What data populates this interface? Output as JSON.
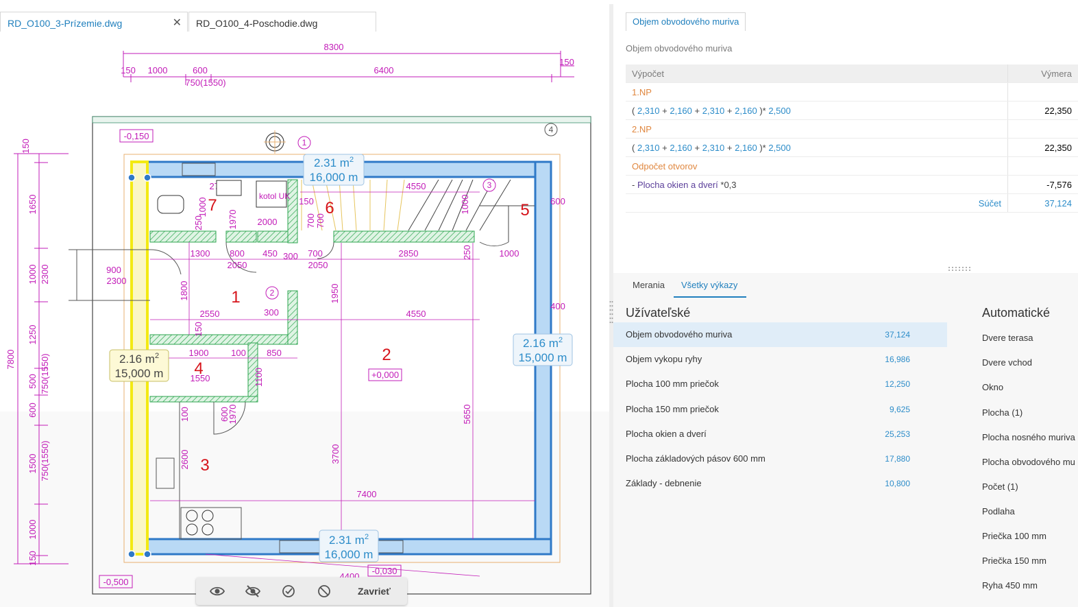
{
  "tabs": [
    {
      "label": "RD_O100_3-Prízemie.dwg",
      "active": true
    },
    {
      "label": "RD_O100_4-Poschodie.dwg",
      "active": false
    }
  ],
  "drawing": {
    "dims_top": [
      "8300",
      "150",
      "1000",
      "600",
      "6400",
      "150",
      "750(1550)"
    ],
    "dims_left": [
      "150",
      "1650",
      "1000",
      "2300",
      "1250",
      "500",
      "750(1550)",
      "600",
      "1500",
      "750(1550)",
      "1000",
      "150",
      "7800"
    ],
    "levels": [
      "-0,150",
      "+0,000",
      "-0,500",
      "-0,030"
    ],
    "rooms": [
      "1",
      "2",
      "3",
      "4",
      "5",
      "6",
      "7"
    ],
    "axis_markers": [
      "1",
      "2",
      "3",
      "4"
    ],
    "inner_dims": [
      "4550",
      "150",
      "2700",
      "2000",
      "800",
      "450",
      "300",
      "700",
      "2850",
      "1000",
      "900",
      "2300",
      "1300",
      "2050",
      "2050",
      "1800",
      "2550",
      "300",
      "4550",
      "1950",
      "1900",
      "100",
      "850",
      "1550",
      "1100",
      "1000",
      "150",
      "250",
      "250",
      "600",
      "1970",
      "1970",
      "700",
      "700",
      "100",
      "2600",
      "3700",
      "5650",
      "7400",
      "600",
      "400",
      "4400",
      "1000"
    ],
    "fixtures": [
      "kotol UK"
    ],
    "measure_labels": [
      {
        "area": "2.31",
        "unit": "m",
        "sup": "2",
        "length": "16,000 m",
        "style": "blue"
      },
      {
        "area": "2.16",
        "unit": "m",
        "sup": "2",
        "length": "15,000 m",
        "style": "yellow"
      },
      {
        "area": "2.16",
        "unit": "m",
        "sup": "2",
        "length": "15,000 m",
        "style": "blue"
      },
      {
        "area": "2.31",
        "unit": "m",
        "sup": "2",
        "length": "16,000 m",
        "style": "blue"
      }
    ]
  },
  "toolbar": {
    "icons": [
      "eye-icon",
      "eye-off-icon",
      "check-circle-icon",
      "prohibit-icon"
    ],
    "close_label": "Zavrieť"
  },
  "calc_panel": {
    "tab": "Objem obvodového muriva",
    "subtitle": "Objem obvodového muriva",
    "header": {
      "calc": "Výpočet",
      "value": "Výmera"
    },
    "sections": [
      {
        "title": "1.NP",
        "formula": [
          "(",
          "2,310",
          "+",
          "2,160",
          "+",
          "2,310",
          "+",
          "2,160",
          ")*",
          "2,500"
        ],
        "value": "22,350"
      },
      {
        "title": "2.NP",
        "formula": [
          "(",
          "2,310",
          "+",
          "2,160",
          "+",
          "2,310",
          "+",
          "2,160",
          ")*",
          "2,500"
        ],
        "value": "22,350"
      },
      {
        "title": "Odpočet otvorov",
        "deduction_prefix": "-",
        "deduction_link": "Plocha okien a dverí",
        "deduction_factor": "*0,3",
        "value": "-7,576"
      }
    ],
    "sum_label": "Súčet",
    "sum_value": "37,124"
  },
  "reports": {
    "tabs": [
      "Merania",
      "Všetky výkazy"
    ],
    "active_tab": "Všetky výkazy",
    "user_title": "Užívateľské",
    "auto_title": "Automatické",
    "user_items": [
      {
        "label": "Objem obvodového muriva",
        "value": "37,124",
        "selected": true
      },
      {
        "label": "Objem vykopu ryhy",
        "value": "16,986"
      },
      {
        "label": "Plocha 100 mm priečok",
        "value": "12,250"
      },
      {
        "label": "Plocha 150 mm priečok",
        "value": "9,625"
      },
      {
        "label": "Plocha okien a dverí",
        "value": "25,253"
      },
      {
        "label": "Plocha základových pásov 600 mm",
        "value": "17,880"
      },
      {
        "label": "Základy - debnenie",
        "value": "10,800"
      }
    ],
    "auto_items": [
      "Dvere terasa",
      "Dvere vchod",
      "Okno",
      "Plocha (1)",
      "Plocha nosného muriva",
      "Plocha obvodového mu",
      "Počet (1)",
      "Podlaha",
      "Priečka 100 mm",
      "Priečka 150 mm",
      "Ryha 450 mm"
    ]
  },
  "colors": {
    "accent": "#1f7fbd",
    "cad_dimension": "#c21bb8",
    "cad_room": "#d6141b",
    "wall_fill": "#b9d9f5",
    "wall_stroke": "#2f79c7",
    "highlight": "#f3ea12",
    "hatch": "#2ba44e",
    "stair": "#f0d88a"
  }
}
